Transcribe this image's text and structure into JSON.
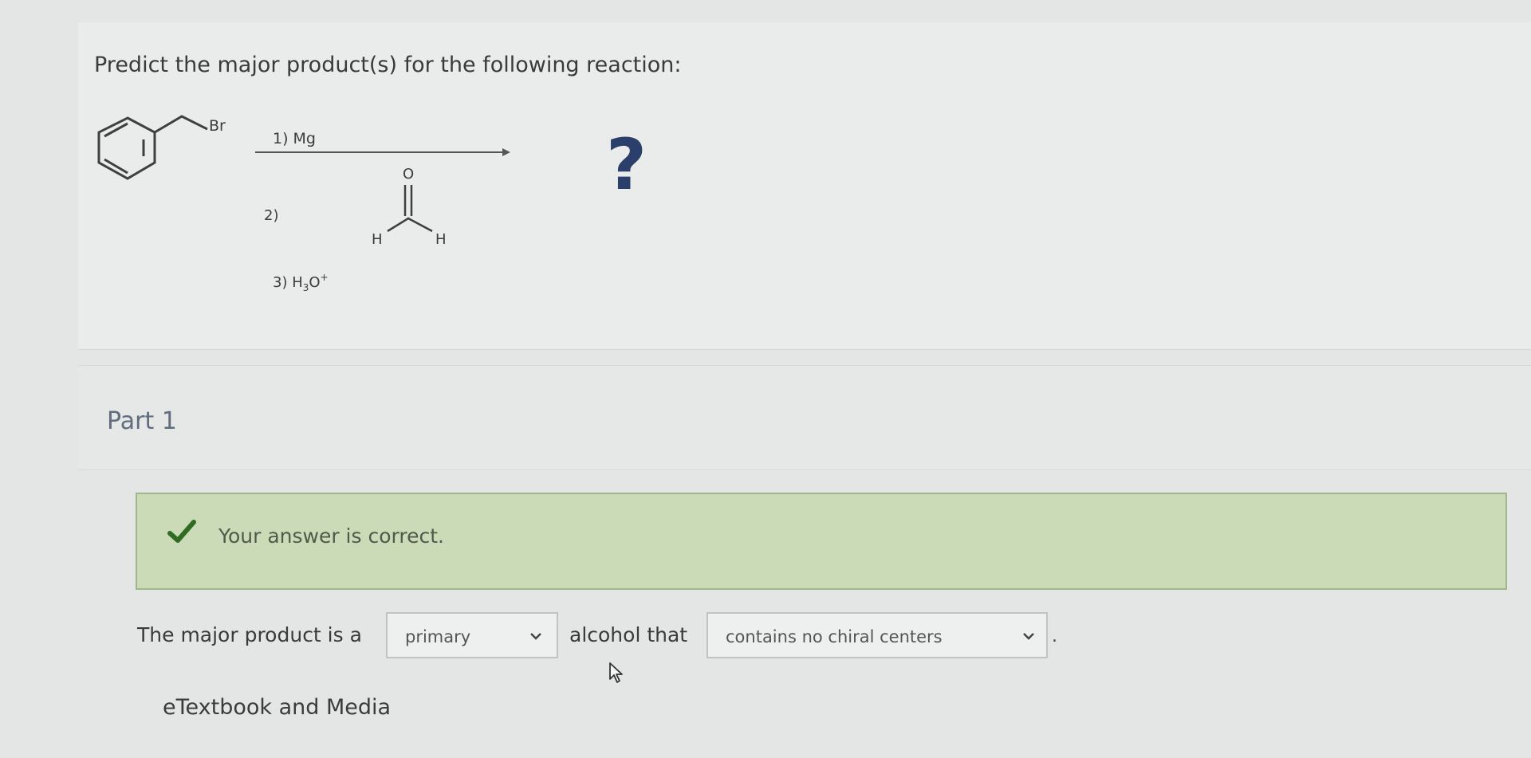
{
  "question": {
    "prompt": "Predict the major product(s) for the following reaction:",
    "reaction": {
      "reactant_label": "Br",
      "step1": "1) Mg",
      "step2_prefix": "2)",
      "aldehyde_o": "O",
      "aldehyde_h_left": "H",
      "aldehyde_h_right": "H",
      "step3_prefix": "3) H",
      "step3_sub": "3",
      "step3_o": "O",
      "step3_sup": "+",
      "product": "?"
    }
  },
  "part": {
    "label": "Part 1"
  },
  "feedback": {
    "icon": "check-icon",
    "message": "Your answer is correct."
  },
  "answer": {
    "text_before": "The major product is a",
    "select1_value": "primary",
    "text_middle": "alcohol that",
    "select2_value": "contains no chiral centers",
    "text_after": "."
  },
  "links": {
    "etextbook": "eTextbook and Media"
  },
  "colors": {
    "feedback_bg": "#cbdbb7",
    "check": "#2f6b20",
    "question_mark": "#2a3f6a"
  }
}
